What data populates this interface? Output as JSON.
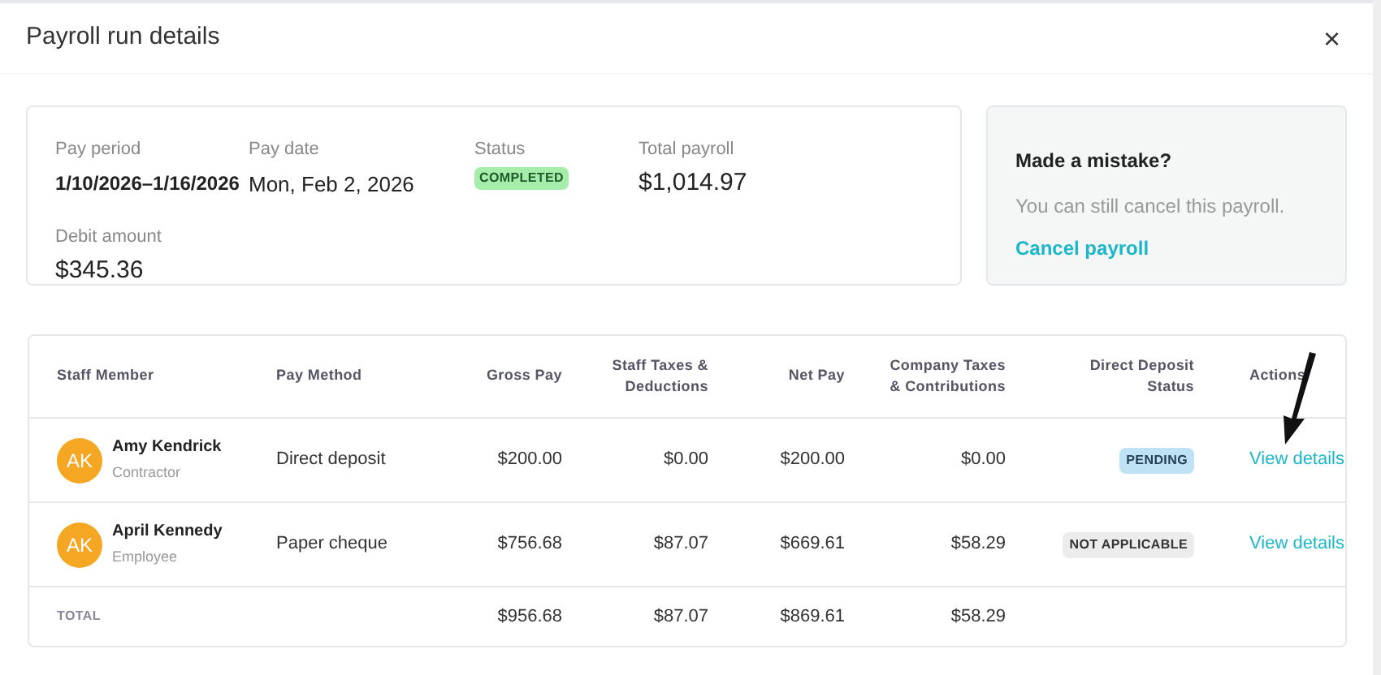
{
  "modal": {
    "title": "Payroll run details",
    "close": "×"
  },
  "summary": {
    "fields": [
      {
        "label": "Pay period",
        "value": "1/10/2026–1/16/2026",
        "kind": "bold"
      },
      {
        "label": "Pay date",
        "value": "Mon, Feb 2, 2026",
        "kind": "text"
      },
      {
        "label": "Status",
        "value": "COMPLETED",
        "kind": "badge"
      },
      {
        "label": "Total payroll",
        "value": "$1,014.97",
        "kind": "large"
      },
      {
        "label": "Debit amount",
        "value": "$345.36",
        "kind": "large"
      }
    ]
  },
  "notice": {
    "title": "Made a mistake?",
    "text": "You can still cancel this payroll.",
    "link": "Cancel payroll"
  },
  "table": {
    "columns": [
      "Staff Member",
      "Pay Method",
      "Gross Pay",
      "Staff Taxes & Deductions",
      "Net Pay",
      "Company Taxes & Contributions",
      "Direct Deposit Status",
      "Actions"
    ],
    "rows": [
      {
        "initials": "AK",
        "name": "Amy Kendrick",
        "role": "Contractor",
        "method": "Direct deposit",
        "gross": "$200.00",
        "staff_taxes": "$0.00",
        "net": "$200.00",
        "company_taxes": "$0.00",
        "status": "PENDING",
        "kind": "pending",
        "action": "View details"
      },
      {
        "initials": "AK",
        "name": "April Kennedy",
        "role": "Employee",
        "method": "Paper cheque",
        "gross": "$756.68",
        "staff_taxes": "$87.07",
        "net": "$669.61",
        "company_taxes": "$58.29",
        "status": "NOT APPLICABLE",
        "kind": "not_applicable",
        "action": "View details"
      }
    ],
    "total": {
      "label": "TOTAL",
      "gross": "$956.68",
      "staff_taxes": "$87.07",
      "net": "$869.61",
      "company_taxes": "$58.29"
    }
  }
}
